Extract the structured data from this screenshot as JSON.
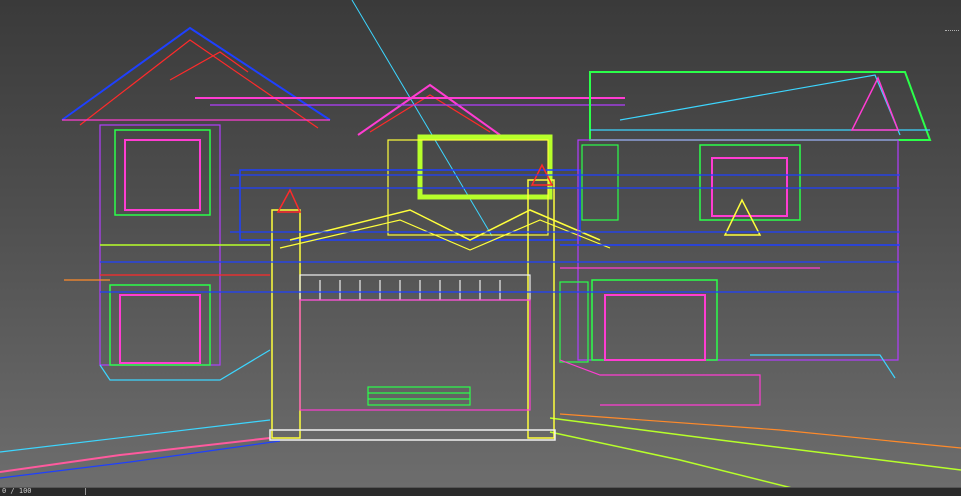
{
  "viewport": {
    "background_top": "#3a3a3a",
    "background_bottom": "#6e6e6e"
  },
  "wire_colors": {
    "blue": "#1e40ff",
    "magenta": "#ff3cd2",
    "pink": "#ff5a9e",
    "yellow": "#ffff3c",
    "lime": "#b7ff2a",
    "green": "#2bff4a",
    "cyan": "#3cd6ff",
    "red": "#ff2a2a",
    "purple": "#b23cff",
    "white": "#f0f0f0",
    "orange": "#ff8a2a"
  },
  "statusbar": {
    "coord_text": "0 / 100"
  }
}
